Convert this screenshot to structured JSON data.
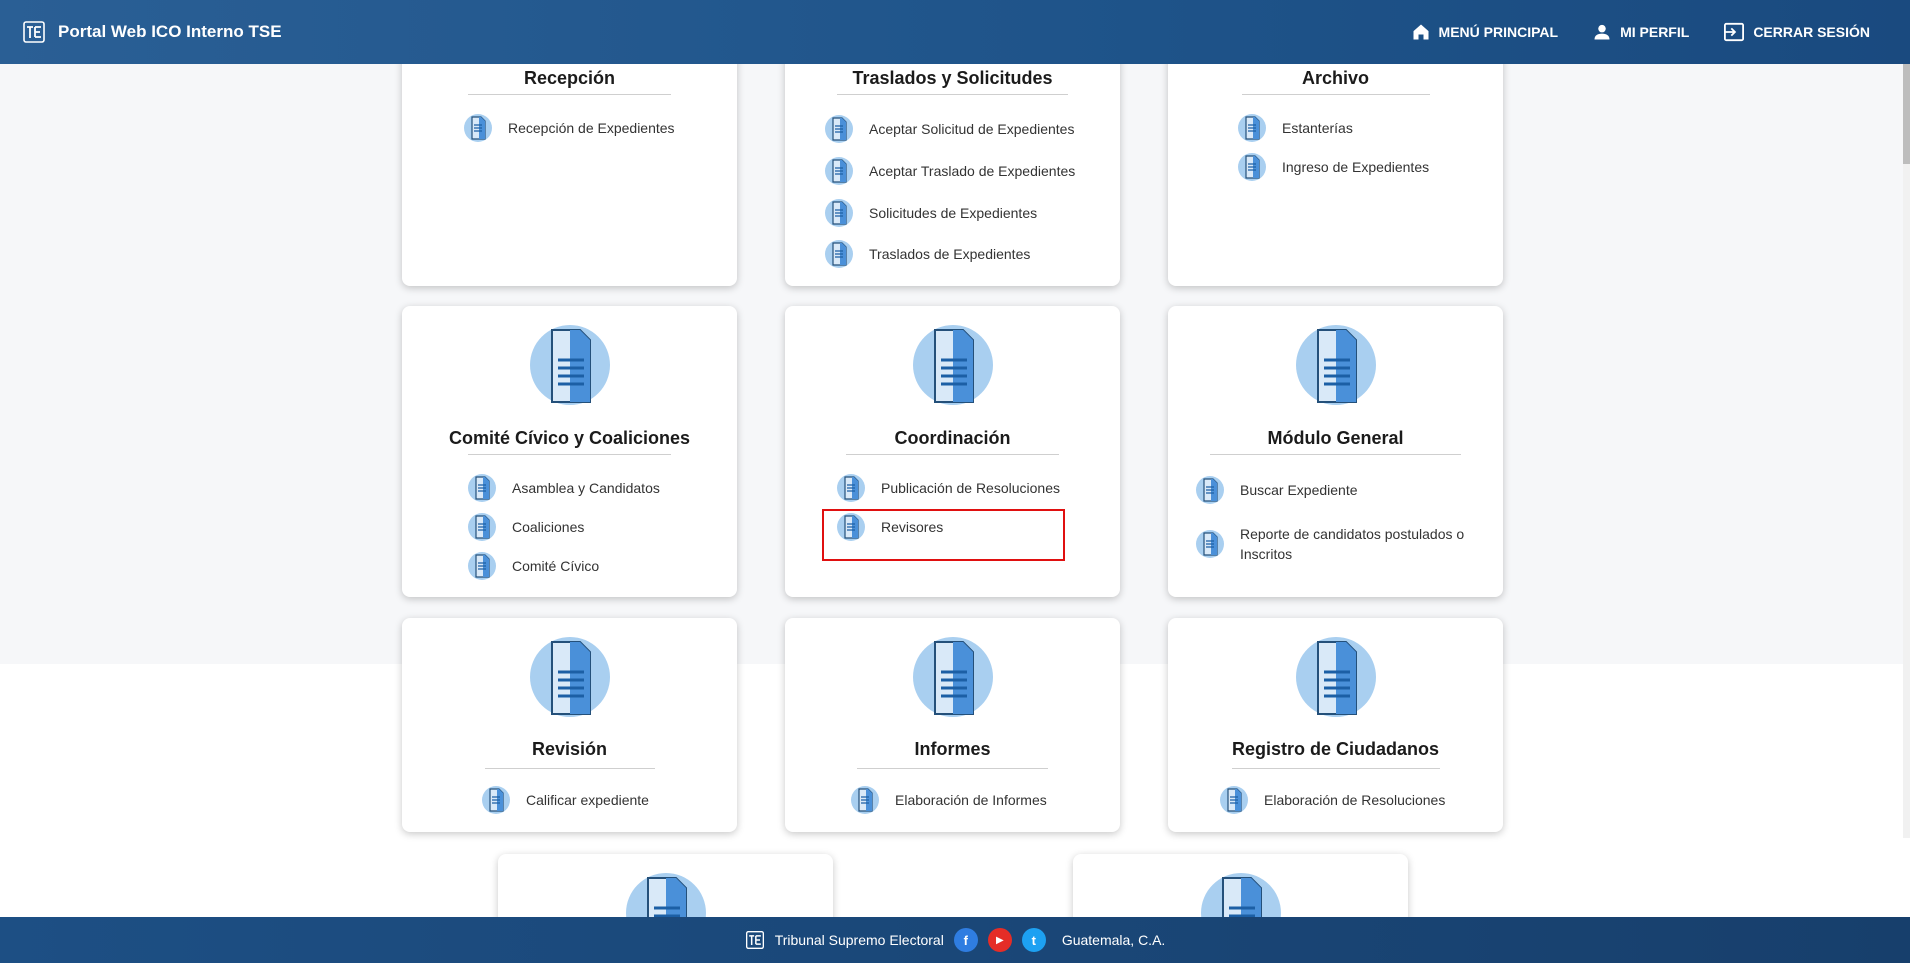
{
  "header": {
    "title": "Portal Web ICO Interno TSE",
    "nav": {
      "menu": "MENÚ PRINCIPAL",
      "profile": "MI PERFIL",
      "logout": "CERRAR SESIÓN"
    }
  },
  "cards": {
    "recepcion": {
      "title": "Recepción",
      "items": [
        "Recepción de Expedientes"
      ]
    },
    "traslados": {
      "title": "Traslados y Solicitudes",
      "items": [
        "Aceptar Solicitud de Expedientes",
        "Aceptar Traslado de Expedientes",
        "Solicitudes de Expedientes",
        "Traslados de Expedientes"
      ]
    },
    "archivo": {
      "title": "Archivo",
      "items": [
        "Estanterías",
        "Ingreso de Expedientes"
      ]
    },
    "comite": {
      "title": "Comité Cívico y Coaliciones",
      "items": [
        "Asamblea y Candidatos",
        "Coaliciones",
        "Comité Cívico"
      ]
    },
    "coordinacion": {
      "title": "Coordinación",
      "items": [
        "Publicación de Resoluciones",
        "Revisores"
      ]
    },
    "modulo_general": {
      "title": "Módulo General",
      "items": [
        "Buscar Expediente",
        "Reporte de candidatos postulados o Inscritos"
      ]
    },
    "revision": {
      "title": "Revisión",
      "items": [
        "Calificar expediente"
      ]
    },
    "informes": {
      "title": "Informes",
      "items": [
        "Elaboración de Informes"
      ]
    },
    "registro": {
      "title": "Registro de Ciudadanos",
      "items": [
        "Elaboración de Resoluciones"
      ]
    }
  },
  "footer": {
    "org": "Tribunal Supremo Electoral",
    "location": "Guatemala, C.A.",
    "social": {
      "facebook": "f",
      "youtube": "▶",
      "twitter": "t"
    }
  },
  "colors": {
    "header": "#1e5389",
    "accent": "#4a90d9",
    "highlight": "#e01010"
  },
  "icons": {
    "menu": "home-icon",
    "profile": "person-icon",
    "logout": "logout-icon",
    "doc": "document-icon"
  }
}
